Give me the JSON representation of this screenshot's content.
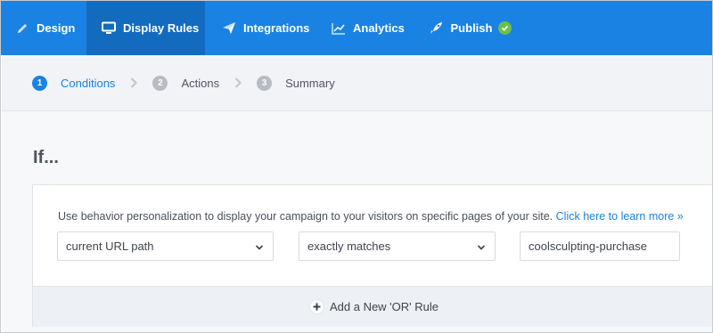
{
  "nav": {
    "items": [
      {
        "label": "Design",
        "icon": "pencil-icon"
      },
      {
        "label": "Display Rules",
        "icon": "monitor-icon",
        "active": true
      },
      {
        "label": "Integrations",
        "icon": "paper-plane-icon"
      },
      {
        "label": "Analytics",
        "icon": "chart-line-icon"
      },
      {
        "label": "Publish",
        "icon": "rocket-icon",
        "badge": "check-circle-icon"
      }
    ],
    "colors": {
      "bar": "#1a82e2",
      "active": "#136bc0",
      "badge": "#6cc04a"
    }
  },
  "steps": [
    {
      "num": "1",
      "label": "Conditions",
      "active": true
    },
    {
      "num": "2",
      "label": "Actions"
    },
    {
      "num": "3",
      "label": "Summary"
    }
  ],
  "main": {
    "heading": "If...",
    "description": "Use behavior personalization to display your campaign to your visitors on specific pages of your site.",
    "learn_more": "Click here to learn more »",
    "condition_select": "current URL path",
    "operator_select": "exactly matches",
    "value_input": "coolsculpting-purchase",
    "add_or_rule": "Add a New 'OR' Rule"
  }
}
